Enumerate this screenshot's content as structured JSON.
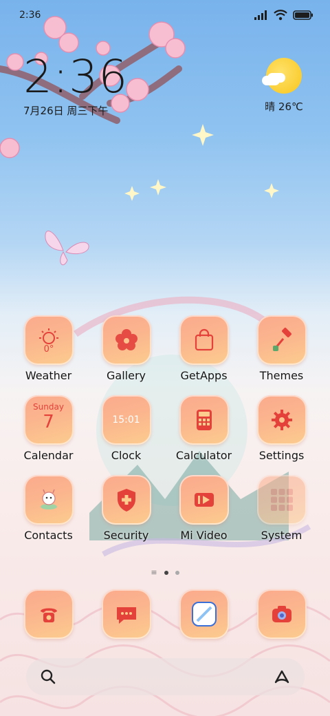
{
  "status_bar": {
    "time": "2:36"
  },
  "clock_widget": {
    "time": "2:36",
    "date": "7月26日 周三下午"
  },
  "weather_widget": {
    "text": "晴 26℃"
  },
  "apps": [
    {
      "label": "Weather",
      "icon": "sun-icon",
      "inner": "0°"
    },
    {
      "label": "Gallery",
      "icon": "flower-icon"
    },
    {
      "label": "GetApps",
      "icon": "shopping-bag-icon"
    },
    {
      "label": "Themes",
      "icon": "paint-roller-icon"
    },
    {
      "label": "Calendar",
      "icon": "calendar-icon",
      "inner_day": "Sunday",
      "inner_num": "7"
    },
    {
      "label": "Clock",
      "icon": "clock-icon",
      "inner": "15:01"
    },
    {
      "label": "Calculator",
      "icon": "calculator-icon"
    },
    {
      "label": "Settings",
      "icon": "gear-icon"
    },
    {
      "label": "Contacts",
      "icon": "contacts-dragon-icon"
    },
    {
      "label": "Security",
      "icon": "shield-icon"
    },
    {
      "label": "Mi Video",
      "icon": "play-icon"
    },
    {
      "label": "System",
      "icon": "folder-grid-icon"
    }
  ],
  "dock": [
    {
      "icon": "phone-icon"
    },
    {
      "icon": "message-icon"
    },
    {
      "icon": "browser-icon"
    },
    {
      "icon": "camera-icon"
    }
  ],
  "colors": {
    "icon_gradient_top": "#fbaa8c",
    "icon_gradient_bottom": "#fccc8f",
    "icon_glyph": "#e4413b"
  }
}
